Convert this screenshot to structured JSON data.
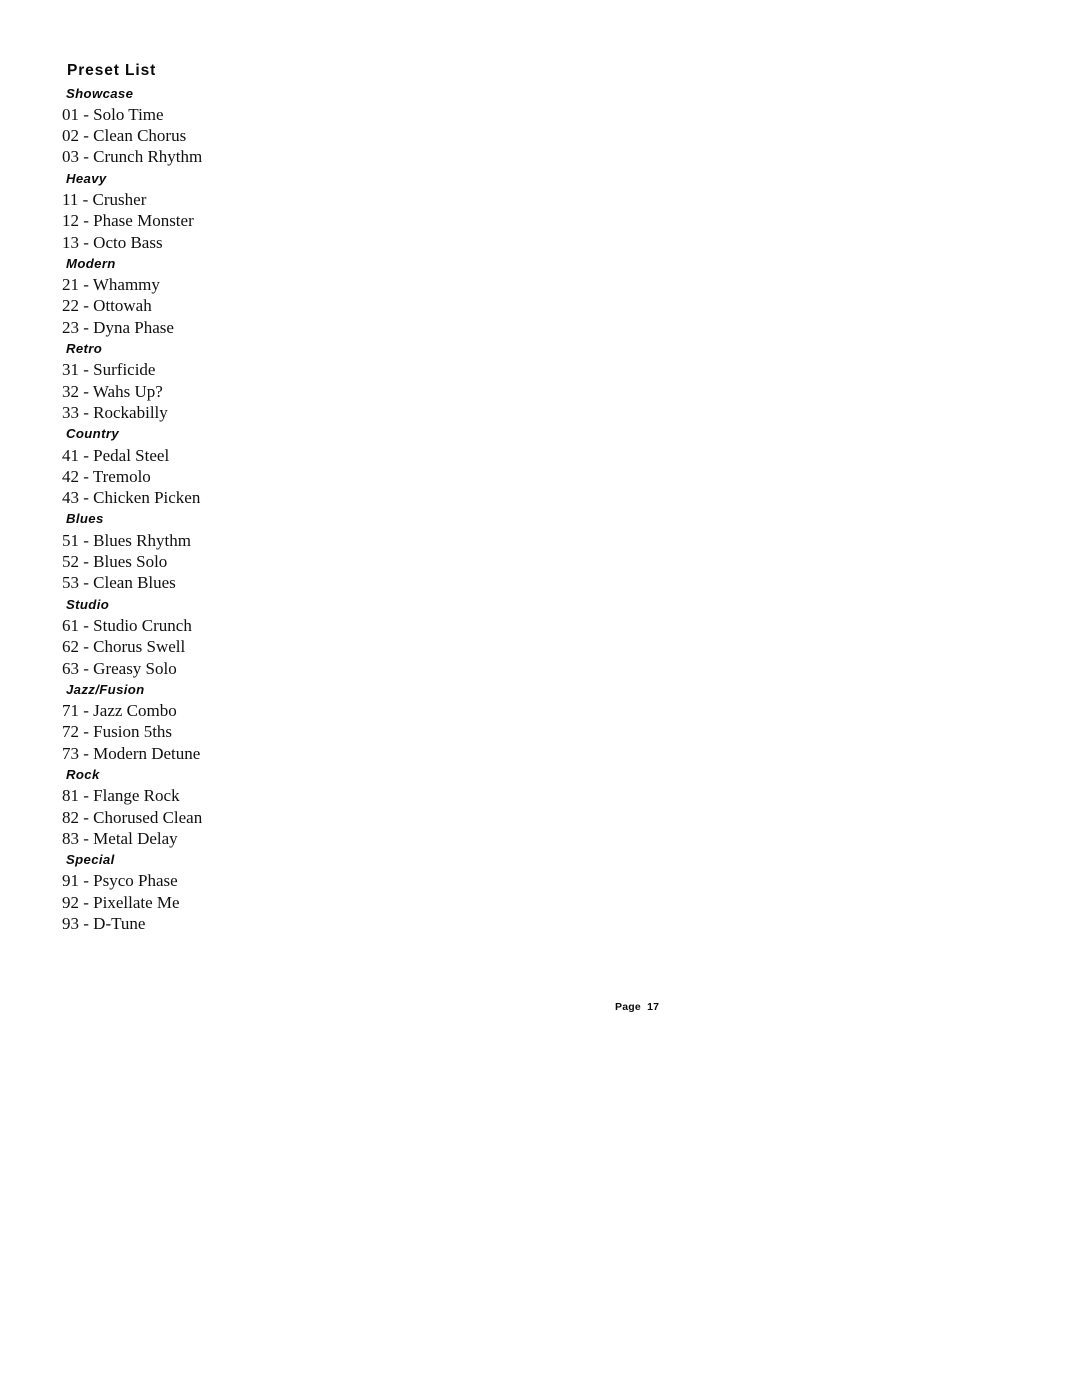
{
  "document": {
    "title": "Preset List",
    "footer": "Page  17",
    "page_number": "17",
    "background_color": "#ffffff",
    "text_color": "#000000"
  },
  "categories": [
    {
      "name": "Showcase",
      "presets": [
        "01 - Solo Time",
        "02 - Clean Chorus",
        "03 - Crunch Rhythm"
      ]
    },
    {
      "name": "Heavy",
      "presets": [
        "11 - Crusher",
        "12 - Phase Monster",
        "13 - Octo Bass"
      ]
    },
    {
      "name": "Modern",
      "presets": [
        "21 - Whammy",
        "22 - Ottowah",
        "23 - Dyna Phase"
      ]
    },
    {
      "name": "Retro",
      "presets": [
        "31 - Surficide",
        "32 - Wahs Up?",
        "33 - Rockabilly"
      ]
    },
    {
      "name": "Country",
      "presets": [
        "41 - Pedal Steel",
        "42 - Tremolo",
        "43 - Chicken Picken"
      ]
    },
    {
      "name": "Blues",
      "presets": [
        "51 - Blues Rhythm",
        "52 - Blues Solo",
        "53 - Clean Blues"
      ]
    },
    {
      "name": "Studio",
      "presets": [
        "61 - Studio Crunch",
        "62 - Chorus Swell",
        "63 - Greasy Solo"
      ]
    },
    {
      "name": "Jazz/Fusion",
      "presets": [
        "71 - Jazz Combo",
        "72 - Fusion 5ths",
        "73 - Modern Detune"
      ]
    },
    {
      "name": "Rock",
      "presets": [
        "81 - Flange Rock",
        "82 - Chorused Clean",
        "83 - Metal Delay"
      ]
    },
    {
      "name": "Special",
      "presets": [
        "91 - Psyco Phase",
        "92 - Pixellate Me",
        "93 - D-Tune"
      ]
    }
  ]
}
